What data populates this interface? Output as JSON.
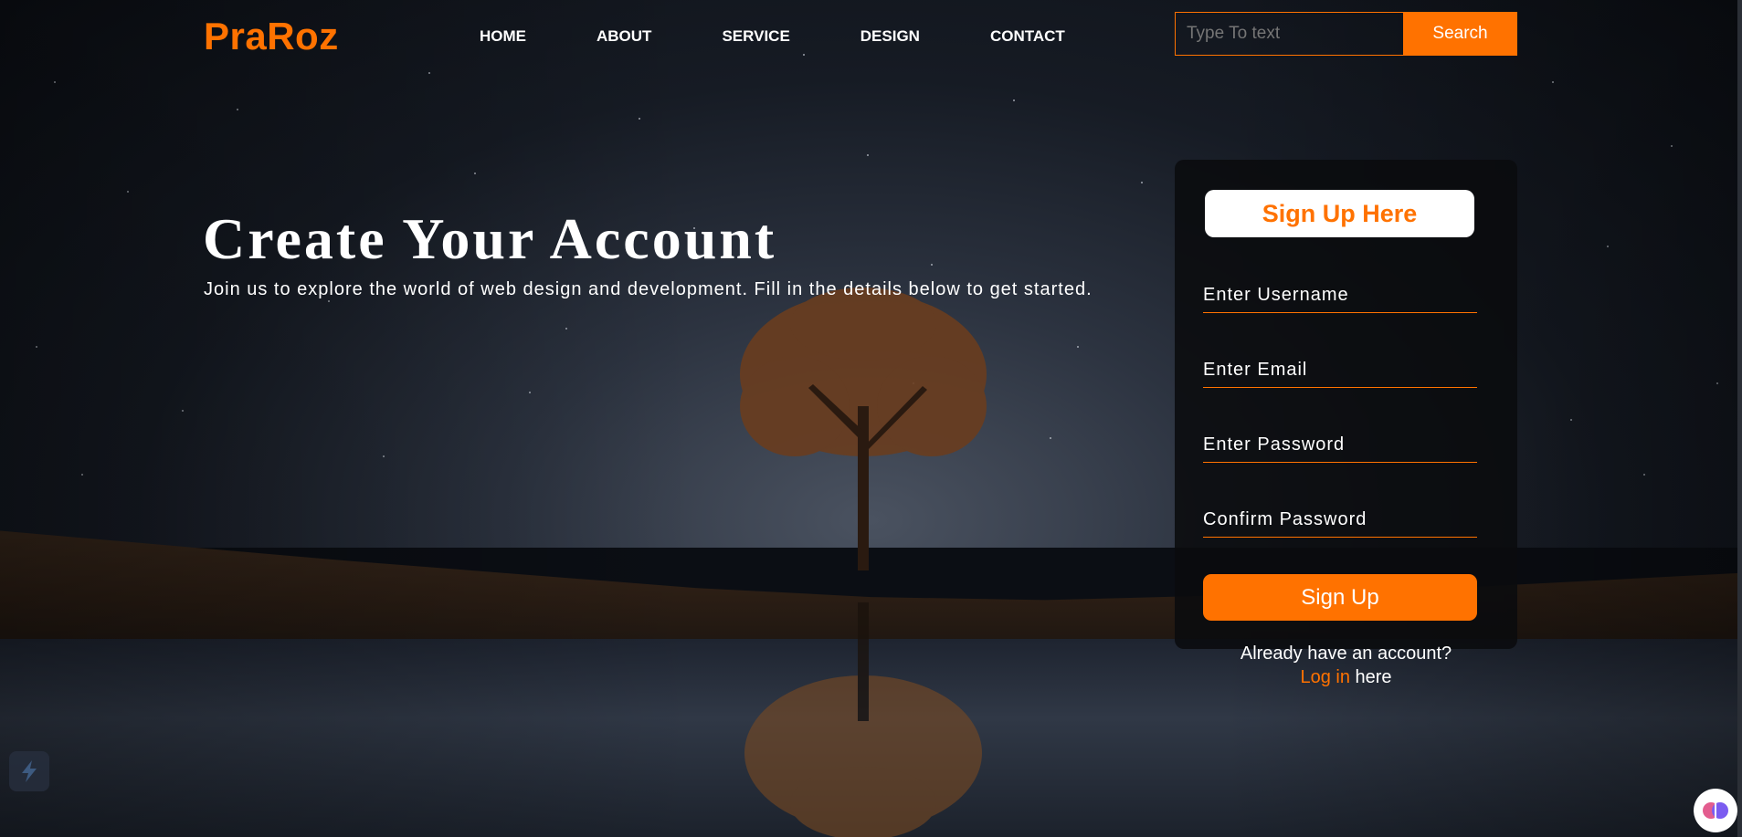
{
  "header": {
    "logo": "PraRoz",
    "nav": [
      "HOME",
      "ABOUT",
      "SERVICE",
      "DESIGN",
      "CONTACT"
    ],
    "search_placeholder": "Type To text",
    "search_button": "Search"
  },
  "hero": {
    "title": "Create Your Account",
    "subtitle": "Join us to explore the world of web design and development. Fill in the details below to get started."
  },
  "form": {
    "title": "Sign Up Here",
    "fields": [
      {
        "placeholder": "Enter Username"
      },
      {
        "placeholder": "Enter Email"
      },
      {
        "placeholder": "Enter Password"
      },
      {
        "placeholder": "Confirm Password"
      }
    ],
    "submit": "Sign Up",
    "login_prompt": "Already have an account?",
    "login_link": "Log in",
    "login_suffix": "here"
  },
  "colors": {
    "accent": "#ff7200",
    "card_bg": "#0a0b0e",
    "text": "#ffffff"
  },
  "icons": {
    "left_widget": "lightning-bolt-icon",
    "right_widget": "brain-icon"
  }
}
